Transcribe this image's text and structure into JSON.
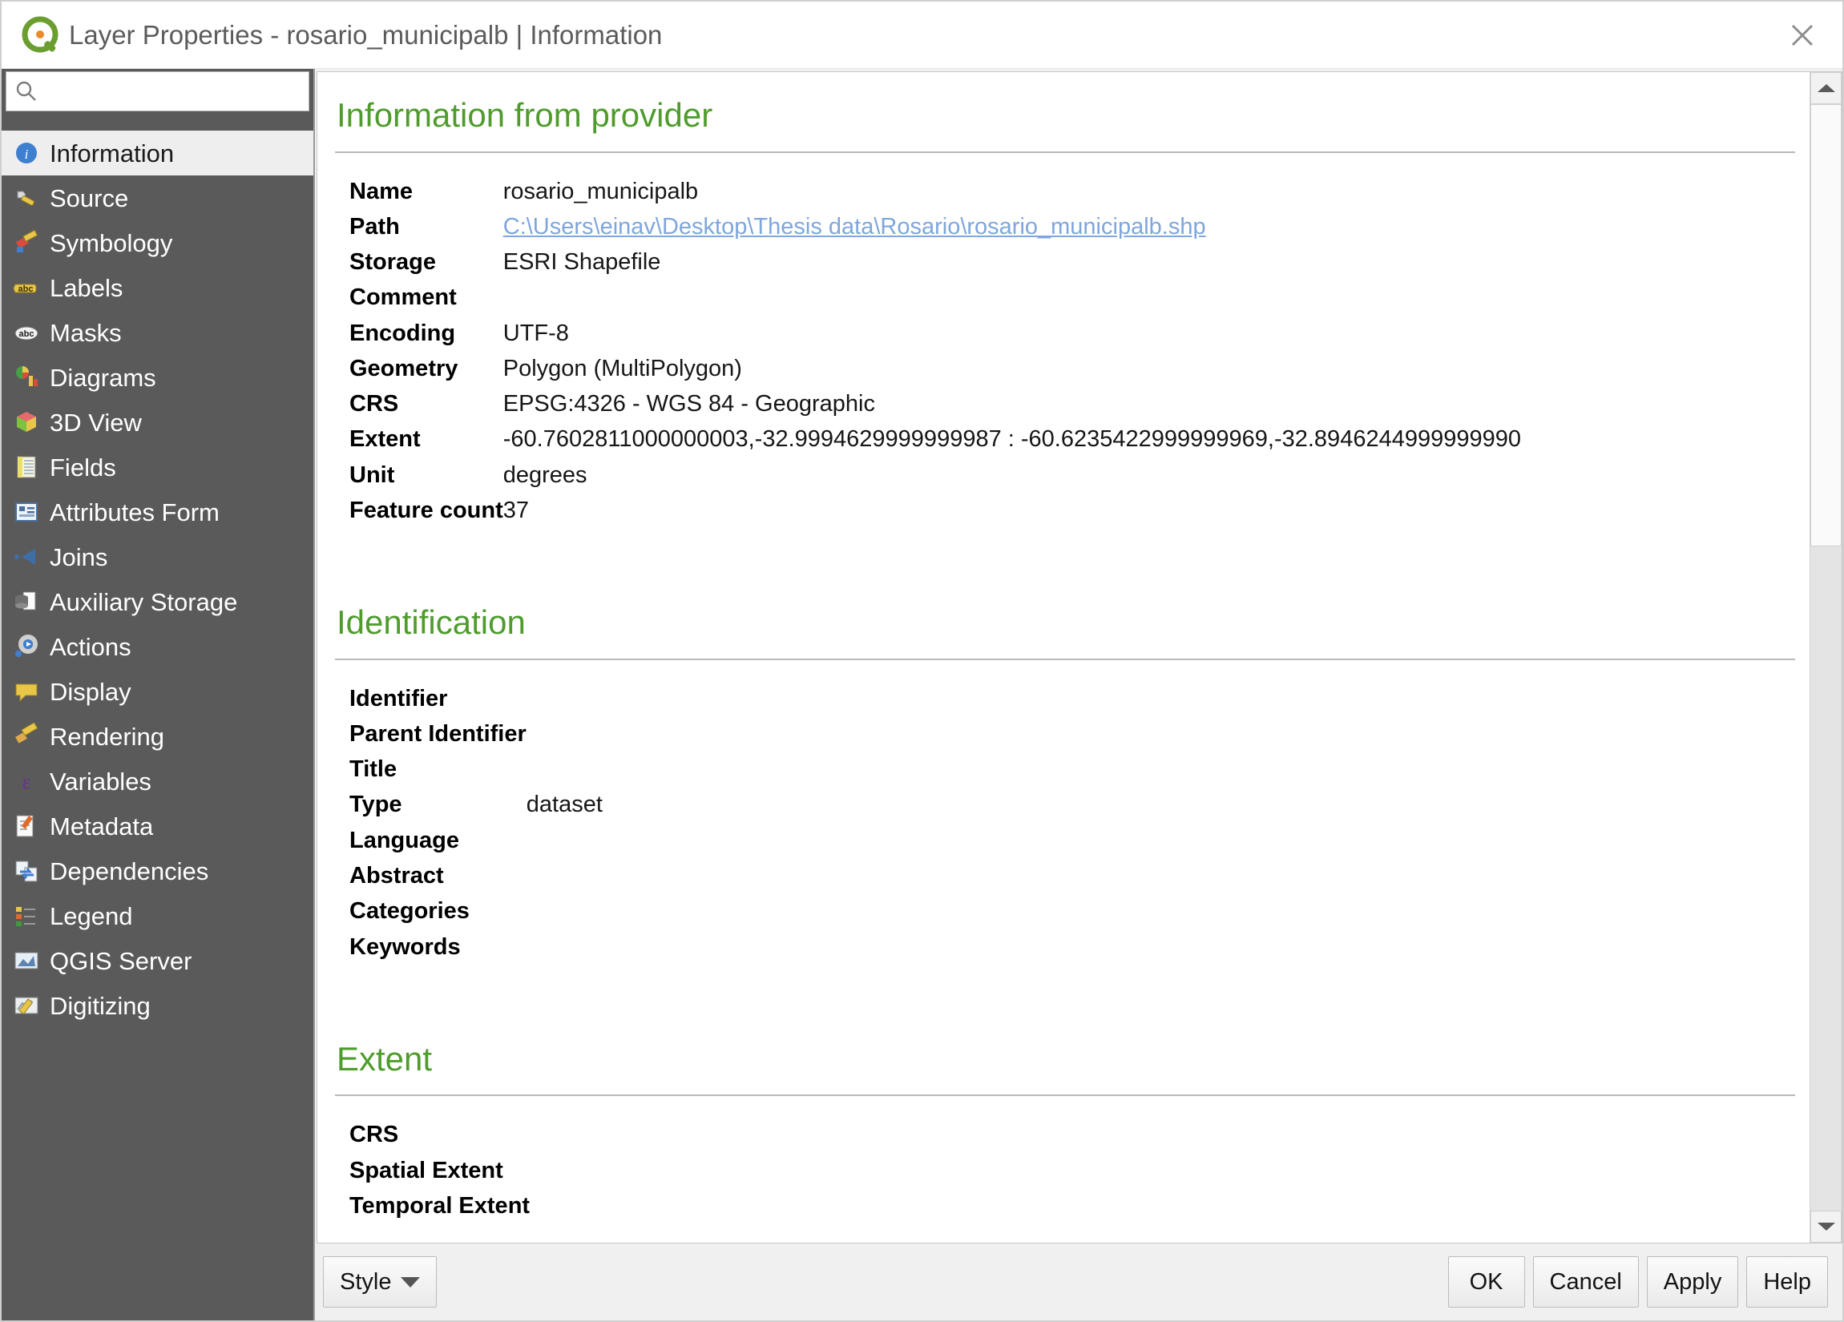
{
  "window": {
    "title": "Layer Properties - rosario_municipalb | Information",
    "logo_icon": "qgis-logo-icon",
    "close_icon": "close-icon"
  },
  "sidebar": {
    "search": {
      "value": "",
      "placeholder": "",
      "icon": "search-icon"
    },
    "items": [
      {
        "label": "Information",
        "icon": "info-icon",
        "selected": true
      },
      {
        "label": "Source",
        "icon": "source-wrench-icon",
        "selected": false
      },
      {
        "label": "Symbology",
        "icon": "symbology-brush-icon",
        "selected": false
      },
      {
        "label": "Labels",
        "icon": "labels-abc-icon",
        "selected": false
      },
      {
        "label": "Masks",
        "icon": "masks-abc-icon",
        "selected": false
      },
      {
        "label": "Diagrams",
        "icon": "diagrams-chart-icon",
        "selected": false
      },
      {
        "label": "3D View",
        "icon": "3d-cube-icon",
        "selected": false
      },
      {
        "label": "Fields",
        "icon": "fields-table-icon",
        "selected": false
      },
      {
        "label": "Attributes Form",
        "icon": "attributes-form-icon",
        "selected": false
      },
      {
        "label": "Joins",
        "icon": "joins-arrow-icon",
        "selected": false
      },
      {
        "label": "Auxiliary Storage",
        "icon": "auxiliary-storage-icon",
        "selected": false
      },
      {
        "label": "Actions",
        "icon": "actions-gear-icon",
        "selected": false
      },
      {
        "label": "Display",
        "icon": "display-balloon-icon",
        "selected": false
      },
      {
        "label": "Rendering",
        "icon": "rendering-brush-icon",
        "selected": false
      },
      {
        "label": "Variables",
        "icon": "variables-epsilon-icon",
        "selected": false
      },
      {
        "label": "Metadata",
        "icon": "metadata-pencil-icon",
        "selected": false
      },
      {
        "label": "Dependencies",
        "icon": "dependencies-sync-icon",
        "selected": false
      },
      {
        "label": "Legend",
        "icon": "legend-list-icon",
        "selected": false
      },
      {
        "label": "QGIS Server",
        "icon": "qgis-server-icon",
        "selected": false
      },
      {
        "label": "Digitizing",
        "icon": "digitizing-pencil-icon",
        "selected": false
      }
    ]
  },
  "content": {
    "sections": [
      {
        "heading": "Information from provider",
        "rows": [
          {
            "key": "Name",
            "value": "rosario_municipalb",
            "link": false
          },
          {
            "key": "Path",
            "value": "C:\\Users\\einav\\Desktop\\Thesis data\\Rosario\\rosario_municipalb.shp",
            "link": true
          },
          {
            "key": "Storage",
            "value": "ESRI Shapefile",
            "link": false
          },
          {
            "key": "Comment",
            "value": "",
            "link": false
          },
          {
            "key": "Encoding",
            "value": "UTF-8",
            "link": false
          },
          {
            "key": "Geometry",
            "value": "Polygon (MultiPolygon)",
            "link": false
          },
          {
            "key": "CRS",
            "value": "EPSG:4326 - WGS 84 - Geographic",
            "link": false
          },
          {
            "key": "Extent",
            "value": "-60.7602811000000003,-32.9994629999999987 : -60.6235422999999969,-32.8946244999999990",
            "link": false
          },
          {
            "key": "Unit",
            "value": "degrees",
            "link": false
          },
          {
            "key": "Feature count",
            "value": "37",
            "link": false
          }
        ]
      },
      {
        "heading": "Identification",
        "rows": [
          {
            "key": "Identifier",
            "value": "",
            "link": false
          },
          {
            "key": "Parent Identifier",
            "value": "",
            "link": false
          },
          {
            "key": "Title",
            "value": "",
            "link": false
          },
          {
            "key": "Type",
            "value": "dataset",
            "link": false
          },
          {
            "key": "Language",
            "value": "",
            "link": false
          },
          {
            "key": "Abstract",
            "value": "",
            "link": false
          },
          {
            "key": "Categories",
            "value": "",
            "link": false
          },
          {
            "key": "Keywords",
            "value": "",
            "link": false
          }
        ]
      },
      {
        "heading": "Extent",
        "rows": [
          {
            "key": "CRS",
            "value": "",
            "link": false
          },
          {
            "key": "Spatial Extent",
            "value": "",
            "link": false
          },
          {
            "key": "Temporal Extent",
            "value": "",
            "link": false
          }
        ]
      }
    ]
  },
  "scrollbar": {
    "up_icon": "chevron-up-icon",
    "down_icon": "chevron-down-icon",
    "thumb_top_pct": 0,
    "thumb_height_pct": 40
  },
  "footer": {
    "style_label": "Style",
    "style_caret_icon": "caret-down-icon",
    "buttons": [
      {
        "label": "OK"
      },
      {
        "label": "Cancel"
      },
      {
        "label": "Apply"
      },
      {
        "label": "Help"
      }
    ]
  },
  "colors": {
    "heading_green": "#4f9c2d",
    "sidebar_bg": "#5a5a5a",
    "selected_bg": "#eeeeee",
    "link_blue": "#7fa6dd",
    "title_grey": "#5b5b5b"
  }
}
